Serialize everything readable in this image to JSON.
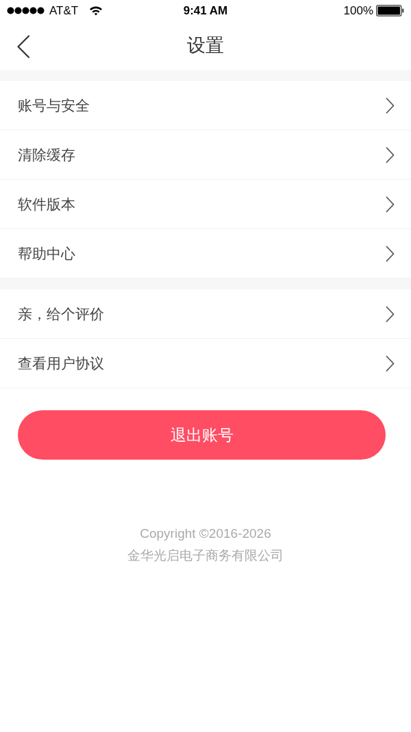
{
  "status_bar": {
    "carrier": "AT&T",
    "time": "9:41 AM",
    "battery": "100%"
  },
  "nav_bar": {
    "title": "设置"
  },
  "sections": [
    {
      "items": [
        {
          "label": "账号与安全"
        },
        {
          "label": "清除缓存"
        },
        {
          "label": "软件版本"
        },
        {
          "label": "帮助中心"
        }
      ]
    },
    {
      "items": [
        {
          "label": "亲，给个评价"
        },
        {
          "label": "查看用户协议"
        }
      ]
    }
  ],
  "logout_button": {
    "label": "退出账号"
  },
  "footer": {
    "copyright": "Copyright ©2016-2026",
    "company": "金华光启电子商务有限公司"
  }
}
